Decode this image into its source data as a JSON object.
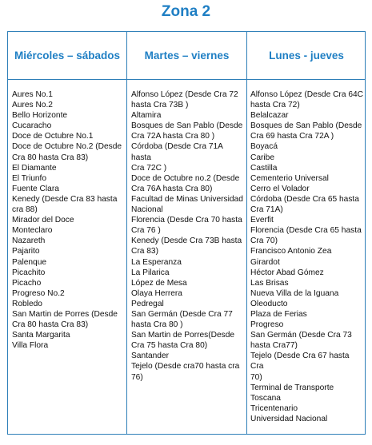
{
  "title": "Zona 2",
  "columns": [
    {
      "header": "Miércoles – sábados",
      "items": [
        "Aures No.1",
        "Aures No.2",
        "Bello Horizonte",
        "Cucaracho",
        "Doce de Octubre No.1",
        "Doce de Octubre No.2 (Desde",
        "Cra 80 hasta Cra 83)",
        "El Diamante",
        "El Triunfo",
        "Fuente Clara",
        "Kenedy (Desde Cra 83 hasta",
        "cra 88)",
        "Mirador del Doce",
        "Monteclaro",
        "Nazareth",
        "Pajarito",
        "Palenque",
        "Picachito",
        "Picacho",
        "Progreso No.2",
        "Robledo",
        "San Martin de Porres (Desde",
        "Cra 80 hasta Cra 83)",
        "Santa Margarita",
        "Villa Flora"
      ]
    },
    {
      "header": "Martes – viernes",
      "items": [
        "Alfonso López (Desde Cra 72",
        "hasta Cra 73B )",
        "Altamira",
        "Bosques de San Pablo (Desde",
        "Cra 72A hasta Cra 80 )",
        "Córdoba (Desde Cra 71A hasta",
        "Cra 72C )",
        "Doce de Octubre no.2 (Desde",
        "Cra 76A hasta Cra 80)",
        "Facultad de Minas Universidad",
        "Nacional",
        "Florencia (Desde Cra 70 hasta",
        "Cra 76 )",
        "Kenedy (Desde Cra 73B hasta",
        "Cra 83)",
        "La Esperanza",
        "La Pilarica",
        "López de Mesa",
        "Olaya Herrera",
        "Pedregal",
        "San Germán (Desde Cra 77",
        "hasta Cra 80 )",
        "San Martin de Porres(Desde",
        "Cra 75 hasta Cra 80)",
        "Santander",
        "Tejelo (Desde cra70 hasta cra",
        "76)"
      ]
    },
    {
      "header": "Lunes - jueves",
      "items": [
        "Alfonso López (Desde Cra 64C",
        "hasta Cra 72)",
        "Belalcazar",
        "Bosques de San Pablo (Desde",
        "Cra 69 hasta Cra 72A )",
        "Boyacá",
        "Caribe",
        "Castilla",
        "Cementerio Universal",
        "Cerro el Volador",
        "Córdoba (Desde Cra 65 hasta",
        "Cra 71A)",
        "Everfit",
        "Florencia (Desde Cra 65 hasta",
        "Cra 70)",
        "Francisco Antonio Zea",
        "Girardot",
        "Héctor Abad Gómez",
        "Las Brisas",
        "Nueva Villa de la Iguana",
        "Oleoducto",
        "Plaza de Ferias",
        "Progreso",
        "San Germán (Desde Cra 73",
        "hasta Cra77)",
        "Tejelo (Desde Cra 67 hasta Cra",
        "70)",
        "Terminal de Transporte",
        "Toscana",
        "Tricentenario",
        "Universidad Nacional"
      ]
    }
  ]
}
